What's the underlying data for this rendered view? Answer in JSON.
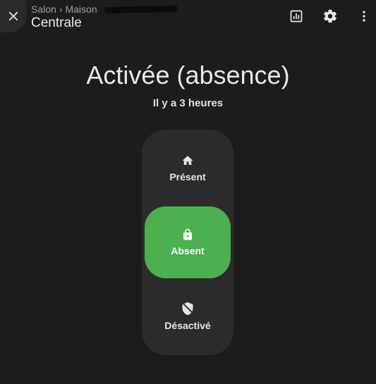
{
  "header": {
    "breadcrumb": [
      "Salon",
      "Maison"
    ],
    "breadcrumb_separator": "›",
    "title": "Centrale"
  },
  "icons": {
    "close": "close-icon",
    "history": "chart-icon",
    "settings": "gear-icon",
    "more": "more-vertical-icon"
  },
  "state": {
    "title": "Activée (absence)",
    "subtitle": "Il y a 3 heures"
  },
  "modes": [
    {
      "label": "Présent",
      "icon": "home-icon",
      "active": false
    },
    {
      "label": "Absent",
      "icon": "lock-icon",
      "active": true
    },
    {
      "label": "Désactivé",
      "icon": "shield-off-icon",
      "active": false
    }
  ],
  "colors": {
    "background": "#1c1c1c",
    "panel": "#2b2b2b",
    "active": "#4caf50"
  }
}
